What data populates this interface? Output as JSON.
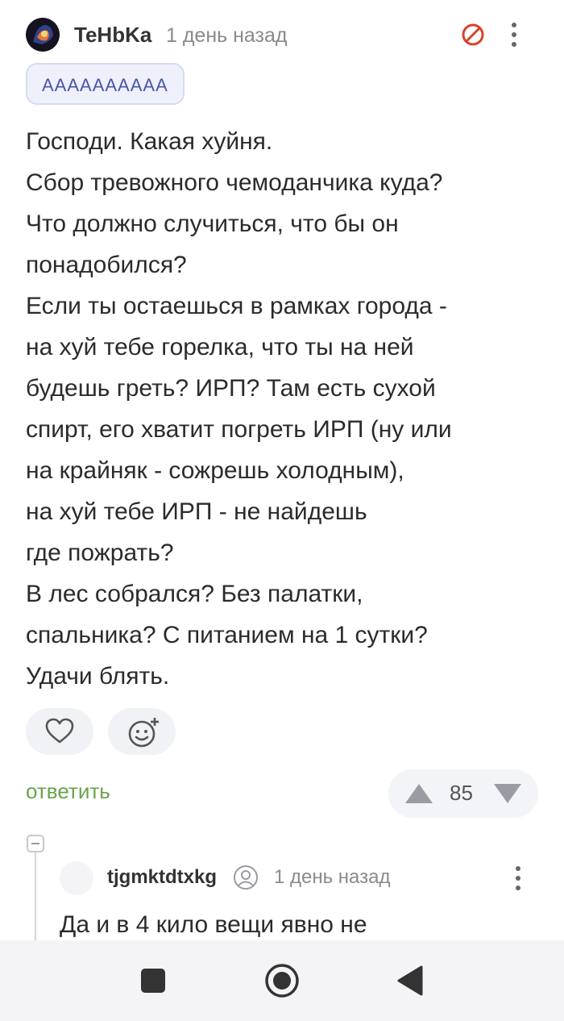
{
  "comment": {
    "author": "TeHbKa",
    "time": "1 день назад",
    "tag": "АААААААААА",
    "lines": [
      "Господи. Какая хуйня.",
      "Сбор тревожного чемоданчика куда?",
      "Что должно случиться, что бы он",
      "понадобился?",
      "Если ты остаешься в рамках города -",
      "на хуй тебе горелка, что ты на ней",
      "будешь греть? ИРП? Там есть сухой",
      "спирт, его хватит погреть ИРП (ну или",
      "на крайняк - сожрешь холодным),",
      "на хуй тебе ИРП - не найдешь",
      "где пожрать?",
      "В лес собрался? Без палатки,",
      "спальника? С питанием на 1 сутки?",
      "Удачи блять."
    ],
    "reply_label": "ответить",
    "rating": "85"
  },
  "reply": {
    "author": "tjgmktdtxkg",
    "time": "1 день назад",
    "text_preview": "Да и в 4 кило вещи явно не"
  },
  "colors": {
    "reply_link": "#6aa34b",
    "block_icon": "#d9412b",
    "tag_text": "#4a55a8"
  },
  "icons": {
    "block": "block-icon",
    "more": "more-vertical-icon",
    "like": "heart-icon",
    "reaction": "add-emoji-icon",
    "vote_up": "arrow-up-icon",
    "vote_down": "arrow-down-icon",
    "user": "user-icon"
  }
}
